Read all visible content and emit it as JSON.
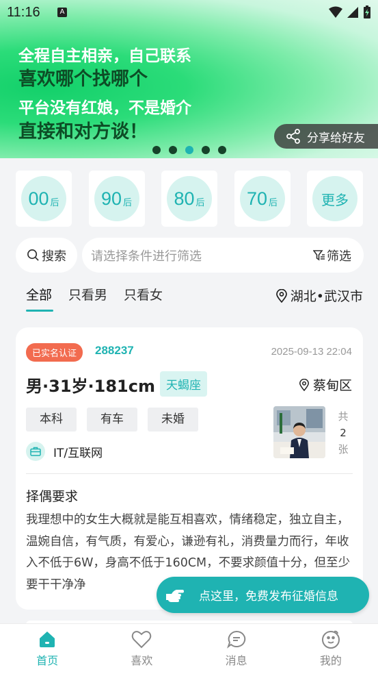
{
  "status_bar": {
    "time": "11:16",
    "notification_icon": "A"
  },
  "banner": {
    "line1": "全程自主相亲，自己联系",
    "line2": "喜欢哪个找哪个",
    "line3": "平台没有红娘，不是婚介",
    "line4": "直接和对方谈！",
    "share_label": "分享给好友",
    "dots_total": 5,
    "dots_active_index": 2
  },
  "age_filters": [
    {
      "num": "00",
      "suffix": "后"
    },
    {
      "num": "90",
      "suffix": "后"
    },
    {
      "num": "80",
      "suffix": "后"
    },
    {
      "num": "70",
      "suffix": "后"
    },
    {
      "num": "更多",
      "suffix": ""
    }
  ],
  "search": {
    "label": "搜索",
    "placeholder": "请选择条件进行筛选",
    "filter_label": "筛选"
  },
  "tabs": [
    "全部",
    "只看男",
    "只看女"
  ],
  "active_tab": 0,
  "location": "湖北•武汉市",
  "card": {
    "verified_badge": "已实名认证",
    "id": "288237",
    "time": "2025-09-13 22:04",
    "title": "男·31岁·181cm",
    "zodiac": "天蝎座",
    "district": "蔡甸区",
    "tags": [
      "本科",
      "有车",
      "未婚"
    ],
    "industry": "IT/互联网",
    "photo_count_prefix": "共",
    "photo_count": "2",
    "photo_count_suffix": "张",
    "requirement_title": "择偶要求",
    "requirement_text": "我理想中的女生大概就是能互相喜欢，情绪稳定，独立自主，温婉自信，有气质，有爱心，谦逊有礼，消费量力而行，年收入不低于6W，身高不低于160CM，不要求颜值十分，但至少要干干净净"
  },
  "cta_label": "点这里，免费发布征婚信息",
  "bottom_nav": [
    {
      "label": "首页",
      "icon": "home-icon"
    },
    {
      "label": "喜欢",
      "icon": "heart-icon"
    },
    {
      "label": "消息",
      "icon": "message-icon"
    },
    {
      "label": "我的",
      "icon": "profile-icon"
    }
  ],
  "colors": {
    "accent": "#1fb3b2",
    "badge": "#f26b4f",
    "banner_green": "#13d06a"
  }
}
